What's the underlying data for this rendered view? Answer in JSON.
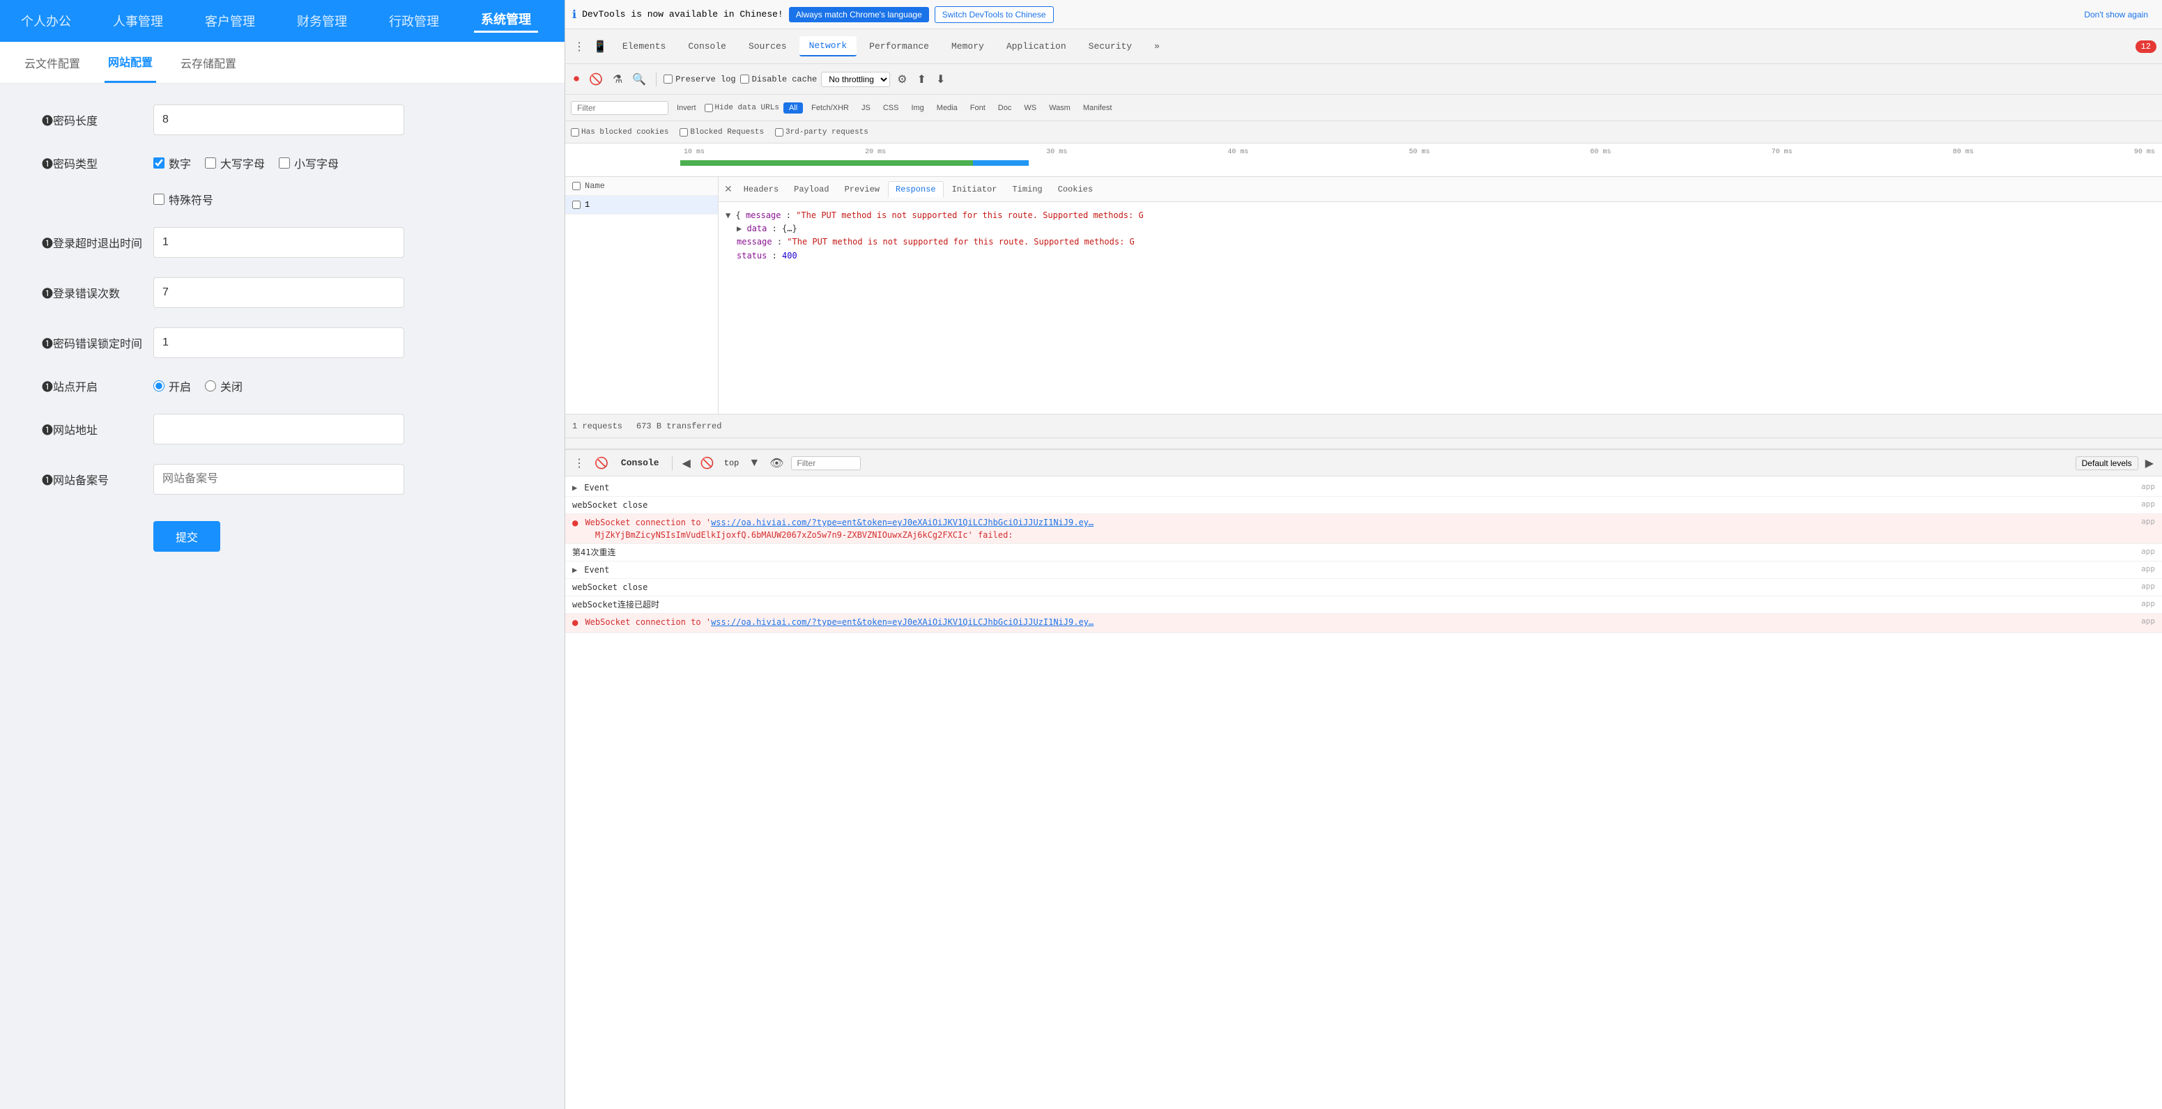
{
  "app": {
    "nav_items": [
      "个人办公",
      "人事管理",
      "客户管理",
      "财务管理",
      "行政管理",
      "系统管理"
    ],
    "active_nav": "系统管理",
    "sub_items": [
      "云文件配置",
      "网站配置",
      "云存储配置"
    ],
    "active_sub": "网站配置",
    "form": {
      "password_length_label": "❶密码长度",
      "password_length_value": "8",
      "password_type_label": "❶密码类型",
      "password_type_options": [
        {
          "label": "数字",
          "checked": true
        },
        {
          "label": "大写字母",
          "checked": false
        },
        {
          "label": "小写字母",
          "checked": false
        }
      ],
      "special_symbol_label": "特殊符号",
      "special_symbol_checked": false,
      "login_timeout_label": "❶登录超时退出时间",
      "login_timeout_value": "1",
      "login_error_label": "❶登录错误次数",
      "login_error_value": "7",
      "password_lock_label": "❶密码错误锁定时间",
      "password_lock_value": "1",
      "site_open_label": "❶站点开启",
      "site_open_options": [
        {
          "label": "开启",
          "checked": true
        },
        {
          "label": "关闭",
          "checked": false
        }
      ],
      "website_url_label": "❶网站地址",
      "website_url_value": "",
      "website_icp_label": "❶网站备案号",
      "website_icp_placeholder": "网站备案号",
      "submit_label": "提交"
    }
  },
  "devtools": {
    "lang_banner": {
      "text": "DevTools is now available in Chinese!",
      "btn_match": "Always match Chrome's language",
      "btn_switch": "Switch DevTools to Chinese",
      "btn_dont_show": "Don't show again"
    },
    "tabs": [
      "Elements",
      "Console",
      "Sources",
      "Network",
      "Performance",
      "Memory",
      "Application",
      "Security"
    ],
    "active_tab": "Network",
    "error_count": "12",
    "network": {
      "preserve_log": "Preserve log",
      "disable_cache": "Disable cache",
      "no_throttling": "No throttling",
      "filter_placeholder": "Filter",
      "invert_label": "Invert",
      "hide_data_urls_label": "Hide data URLs",
      "filter_types": [
        "All",
        "Fetch/XHR",
        "JS",
        "CSS",
        "Img",
        "Media",
        "Font",
        "Doc",
        "WS",
        "Wasm",
        "Manifest"
      ],
      "active_filter": "All",
      "has_blocked_cookies": "Has blocked cookies",
      "blocked_requests": "Blocked Requests",
      "third_party_requests": "3rd-party requests",
      "timeline_labels": [
        "10 ms",
        "20 ms",
        "30 ms",
        "40 ms",
        "50 ms",
        "60 ms",
        "70 ms",
        "80 ms",
        "90 ms"
      ],
      "requests": [
        {
          "id": "1",
          "name": "1"
        }
      ],
      "detail_tabs": [
        "Headers",
        "Payload",
        "Preview",
        "Response",
        "Initiator",
        "Timing",
        "Cookies"
      ],
      "active_detail_tab": "Response",
      "response_content": {
        "line1": "▼ {message: \"The PUT method is not supported for this route. Supported methods: G",
        "line2": "  ▶ data: {…}",
        "line3": "    message: \"The PUT method is not supported for this route. Supported methods: G",
        "line4": "    status: 400"
      },
      "status_bar": {
        "requests": "1 requests",
        "transferred": "673 B transferred"
      }
    },
    "console": {
      "label": "Console",
      "toolbar": {
        "top_label": "top",
        "filter_placeholder": "Filter",
        "default_levels": "Default levels"
      },
      "rows": [
        {
          "type": "expand",
          "text": "▶ Event",
          "source": "app"
        },
        {
          "type": "info",
          "text": "webSocket close",
          "source": "app"
        },
        {
          "type": "error",
          "text": "● WebSocket connection to 'wss://oa.hiviai.com/?type=ent&token=eyJ0eXAiOiJKV1QiLCJhbGciOiJJUzI1NiJ9.ey…  MjZkYjBmZicyNSIsImVudElkIjoxfQ.6bMAUW2067xZo5w7n9-ZXBVZNIOuwxZAj6kCg2FXCIc' failed:",
          "source": "app"
        },
        {
          "type": "info",
          "text": "第41次重连",
          "source": "app"
        },
        {
          "type": "expand",
          "text": "▶ Event",
          "source": "app"
        },
        {
          "type": "info",
          "text": "webSocket close",
          "source": "app"
        },
        {
          "type": "info",
          "text": "webSocket连接已超时",
          "source": "app"
        },
        {
          "type": "error",
          "text": "● WebSocket connection to 'wss://oa.hiviai.com/?type=ent&token=eyJ0eXAiOiJKV1QiLCJhbGciOiJJUzI1NiJ9.ey…",
          "source": "app"
        }
      ]
    }
  }
}
